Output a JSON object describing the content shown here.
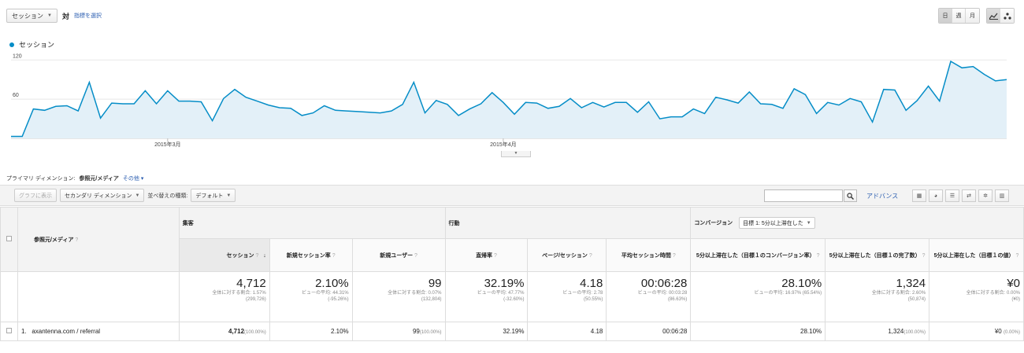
{
  "top": {
    "metric_select": "セッション",
    "vs_label": "対",
    "select_metric_link": "指標を選択",
    "period_buttons": [
      "日",
      "週",
      "月"
    ]
  },
  "chart_data": {
    "type": "area",
    "series": [
      {
        "name": "セッション",
        "values": [
          3,
          3,
          45,
          43,
          49,
          50,
          42,
          86,
          31,
          54,
          53,
          53,
          73,
          53,
          73,
          57,
          57,
          56,
          27,
          61,
          75,
          63,
          57,
          51,
          47,
          46,
          35,
          39,
          50,
          43,
          42,
          41,
          40,
          39,
          42,
          52,
          86,
          39,
          58,
          52,
          35,
          45,
          53,
          70,
          55,
          37,
          55,
          54,
          46,
          49,
          61,
          47,
          55,
          48,
          55,
          55,
          40,
          56,
          30,
          33,
          33,
          45,
          38,
          63,
          59,
          54,
          71,
          53,
          52,
          46,
          76,
          67,
          38,
          55,
          51,
          61,
          56,
          25,
          75,
          74,
          43,
          58,
          80,
          57,
          118,
          108,
          110,
          98,
          88,
          90
        ]
      }
    ],
    "x_ticks": [
      {
        "index": 14,
        "label": "2015年3月"
      },
      {
        "index": 44,
        "label": "2015年4月"
      }
    ],
    "y_ticks": [
      60,
      120
    ],
    "ylim": [
      0,
      130
    ],
    "grid": true,
    "colors": {
      "line": "#058dc7",
      "fill": "#e3f0f8"
    }
  },
  "dimension": {
    "label": "プライマリ ディメンション:",
    "current": "参照元/メディア",
    "other": "その他"
  },
  "toolbar": {
    "plot_rows": "グラフに表示",
    "secondary_dim": "セカンダリ ディメンション",
    "sort_type_label": "並べ替えの種類:",
    "sort_type": "デフォルト",
    "advanced": "アドバンス"
  },
  "table": {
    "dim_header": "参照元/メディア",
    "groups": {
      "acquisition": "集客",
      "behavior": "行動",
      "conversion": "コンバージョン",
      "goal_select": "目標 1: 5分以上滞在した"
    },
    "columns": [
      "セッション",
      "新規セッション率",
      "新規ユーザー",
      "直帰率",
      "ページ/セッション",
      "平均セッション時間",
      "5分以上滞在した（目標１のコンバージョン率）",
      "5分以上滞在した（目標１の完了数）",
      "5分以上滞在した（目標１の値）"
    ],
    "totals": [
      {
        "value": "4,712",
        "sub1": "全体に対する割合: 1.57%",
        "sub2": "(299,726)"
      },
      {
        "value": "2.10%",
        "sub1": "ビューの平均: 44.31%",
        "sub2": "(-95.26%)"
      },
      {
        "value": "99",
        "sub1": "全体に対する割合: 0.07%",
        "sub2": "(132,804)"
      },
      {
        "value": "32.19%",
        "sub1": "ビューの平均: 47.77%",
        "sub2": "(-32.60%)"
      },
      {
        "value": "4.18",
        "sub1": "ビューの平均: 2.78",
        "sub2": "(50.55%)"
      },
      {
        "value": "00:06:28",
        "sub1": "ビューの平均: 00:03:28",
        "sub2": "(86.63%)"
      },
      {
        "value": "28.10%",
        "sub1": "ビューの平均: 16.97% (65.54%)",
        "sub2": ""
      },
      {
        "value": "1,324",
        "sub1": "全体に対する割合: 2.60%",
        "sub2": "(50,874)"
      },
      {
        "value": "¥0",
        "sub1": "全体に対する割合: 0.00%",
        "sub2": "(¥0)"
      }
    ],
    "rows": [
      {
        "index": "1.",
        "name": "axantenna.com / referral",
        "cells": [
          {
            "v": "4,712",
            "p": "(100.00%)"
          },
          {
            "v": "2.10%",
            "p": ""
          },
          {
            "v": "99",
            "p": "(100.00%)"
          },
          {
            "v": "32.19%",
            "p": ""
          },
          {
            "v": "4.18",
            "p": ""
          },
          {
            "v": "00:06:28",
            "p": ""
          },
          {
            "v": "28.10%",
            "p": ""
          },
          {
            "v": "1,324",
            "p": "(100.00%)"
          },
          {
            "v": "¥0",
            "p": "(0.00%)"
          }
        ]
      }
    ]
  }
}
